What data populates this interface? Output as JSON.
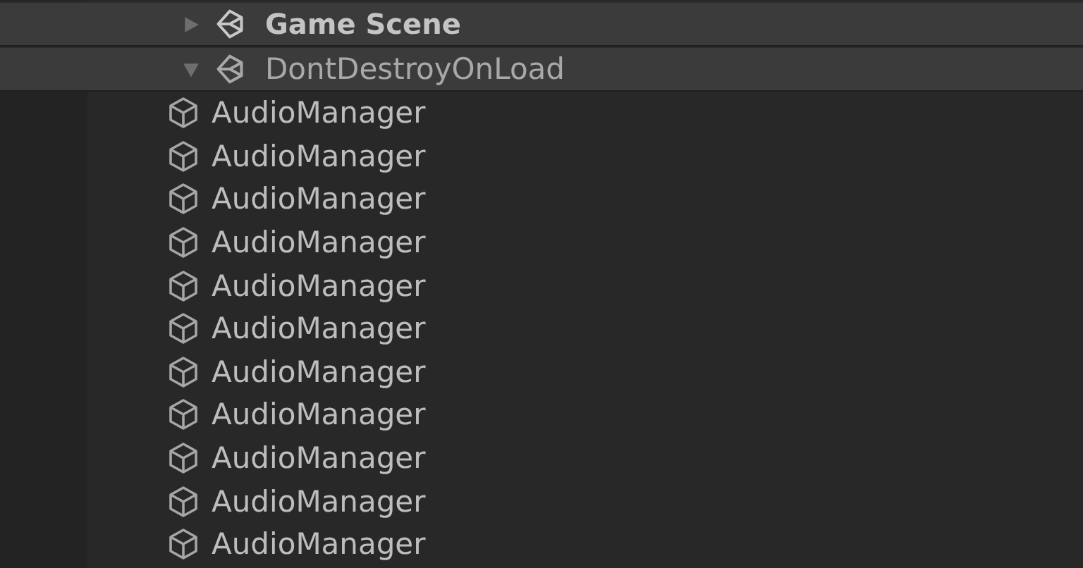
{
  "hierarchy": [
    {
      "name": "Game Scene",
      "expanded": false,
      "active": true
    },
    {
      "name": "DontDestroyOnLoad",
      "expanded": true,
      "active": false,
      "children": [
        {
          "name": "AudioManager"
        },
        {
          "name": "AudioManager"
        },
        {
          "name": "AudioManager"
        },
        {
          "name": "AudioManager"
        },
        {
          "name": "AudioManager"
        },
        {
          "name": "AudioManager"
        },
        {
          "name": "AudioManager"
        },
        {
          "name": "AudioManager"
        },
        {
          "name": "AudioManager"
        },
        {
          "name": "AudioManager"
        },
        {
          "name": "AudioManager"
        }
      ]
    }
  ]
}
